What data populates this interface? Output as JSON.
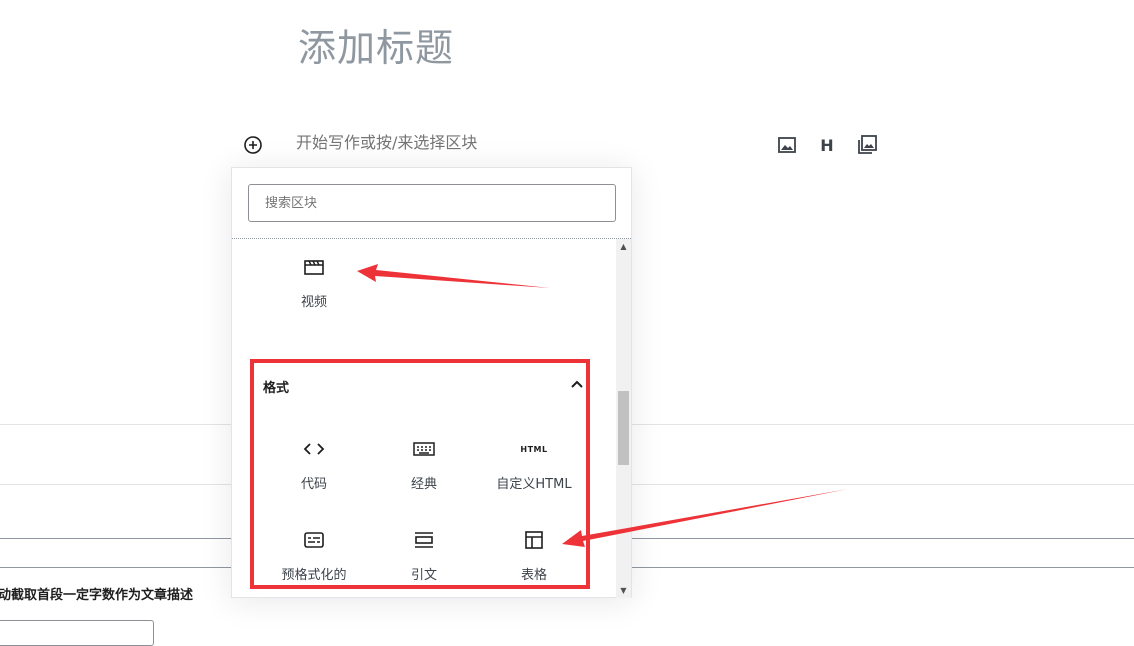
{
  "editor": {
    "title_placeholder": "添加标题",
    "paragraph_placeholder": "开始写作或按/来选择区块"
  },
  "toolbar": {
    "buttons": [
      {
        "name": "image-icon",
        "label": ""
      },
      {
        "name": "heading-icon",
        "label": "H"
      },
      {
        "name": "gallery-icon",
        "label": ""
      }
    ]
  },
  "inserter": {
    "search_placeholder": "搜索区块",
    "media_items": [
      {
        "label": "视频",
        "icon": "video-icon"
      }
    ],
    "category": {
      "title": "格式",
      "items": [
        {
          "label": "代码",
          "icon": "code-icon"
        },
        {
          "label": "经典",
          "icon": "keyboard-icon"
        },
        {
          "label": "自定义HTML",
          "icon": "html-icon",
          "icon_text": "HTML"
        },
        {
          "label": "预格式化的",
          "icon": "preformatted-icon"
        },
        {
          "label": "引文",
          "icon": "pullquote-icon"
        },
        {
          "label": "表格",
          "icon": "table-icon"
        }
      ]
    }
  },
  "meta": {
    "excerpt_label": "动截取首段一定字数作为文章描述"
  },
  "colors": {
    "annotation_red": "#ee3338",
    "title_gray": "#8f98a1"
  }
}
